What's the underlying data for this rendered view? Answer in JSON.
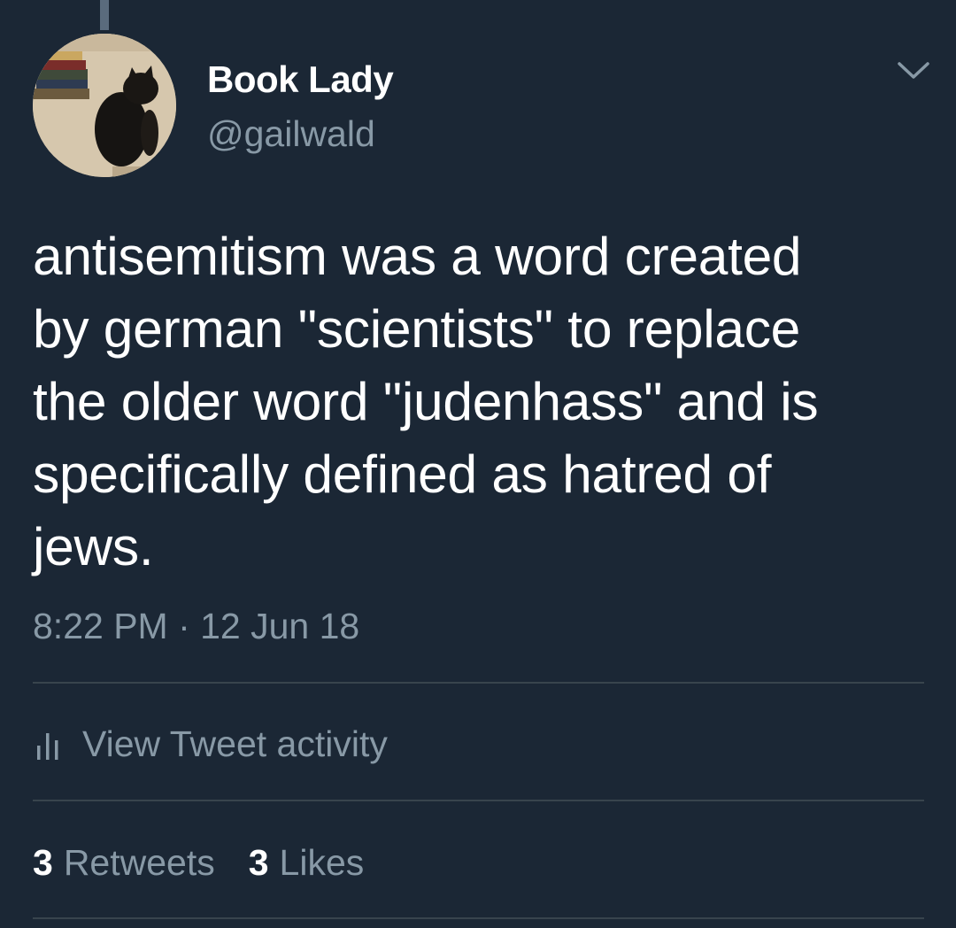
{
  "user": {
    "display_name": "Book Lady",
    "handle": "@gailwald"
  },
  "tweet": {
    "text": "antisemitism was a word created\nby german \"scientists\" to replace\nthe older word \"judenhass\" and is\nspecifically defined as hatred of\njews.",
    "timestamp": "8:22 PM · 12 Jun 18"
  },
  "activity": {
    "label": "View Tweet activity",
    "icon": "bar-chart-icon"
  },
  "stats": {
    "retweets_count": "3",
    "retweets_label": "Retweets",
    "likes_count": "3",
    "likes_label": "Likes"
  },
  "colors": {
    "background": "#1b2735",
    "primary_text": "#ffffff",
    "secondary_text": "#8899a6",
    "divider": "#38444d"
  }
}
